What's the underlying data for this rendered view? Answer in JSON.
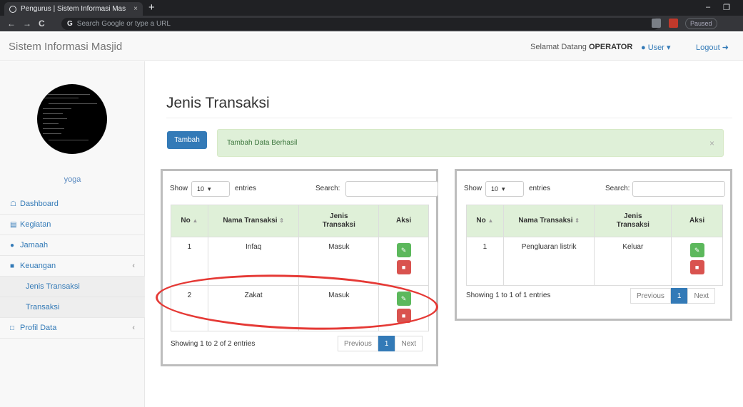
{
  "browser": {
    "tab_title": "Pengurus | Sistem Informasi Mas",
    "tab_close": "×",
    "new_tab": "+",
    "address_placeholder": "Search Google or type a URL",
    "google_glyph": "G",
    "paused_label": "Paused",
    "nav": {
      "back": "←",
      "forward": "→",
      "reload": "C"
    },
    "window": {
      "minimize": "–",
      "restore": "❐"
    }
  },
  "header": {
    "brand": "Sistem Informasi Masjid",
    "welcome_prefix": "Selamat Datang",
    "welcome_user": "OPERATOR",
    "user_menu": "User ▾",
    "logout": "Logout"
  },
  "sidebar": {
    "username": "yoga",
    "items": [
      {
        "label": "Dashboard",
        "icon": "home-icon"
      },
      {
        "label": "Kegiatan",
        "icon": "list-icon"
      },
      {
        "label": "Jamaah",
        "icon": "users-icon"
      },
      {
        "label": "Keuangan",
        "icon": "wallet-icon",
        "chevron": "‹"
      },
      {
        "label": "Jenis Transaksi"
      },
      {
        "label": "Transaksi"
      },
      {
        "label": "Profil Data",
        "icon": "file-icon",
        "chevron": "‹"
      }
    ]
  },
  "main": {
    "title": "Jenis Transaksi",
    "add_button": "Tambah",
    "alert": "Tambah Data Berhasil",
    "alert_close": "×"
  },
  "table_common": {
    "show": "Show",
    "entries_select": "10",
    "entries": "entries",
    "search": "Search:",
    "col_no": "No",
    "col_nama": "Nama Transaksi",
    "col_jenis_1": "Jenis",
    "col_jenis_2": "Transaksi",
    "col_aksi": "Aksi",
    "sort_asc": "▲",
    "sort_both": "⇕",
    "previous": "Previous",
    "page": "1",
    "next": "Next"
  },
  "table_masuk": {
    "rows": [
      {
        "no": "1",
        "nama": "Infaq",
        "jenis": "Masuk"
      },
      {
        "no": "2",
        "nama": "Zakat",
        "jenis": "Masuk"
      }
    ],
    "info": "Showing 1 to 2 of 2 entries"
  },
  "table_keluar": {
    "rows": [
      {
        "no": "1",
        "nama": "Pengluaran listrik",
        "jenis": "Keluar"
      }
    ],
    "info": "Showing 1 to 1 of 1 entries"
  },
  "colors": {
    "primary": "#337ab7",
    "success": "#5cb85c",
    "danger": "#d9534f",
    "header_green": "#dff0d8",
    "highlight": "#e53935"
  }
}
